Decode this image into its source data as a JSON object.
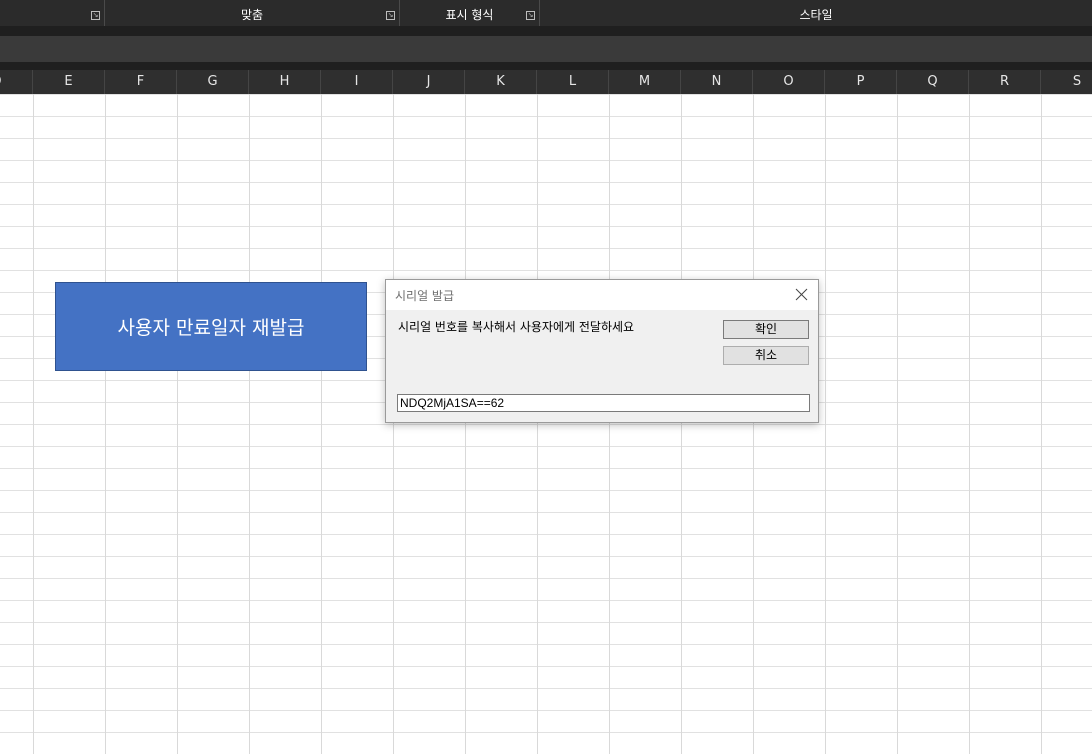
{
  "ribbon": {
    "groups": [
      {
        "label": ""
      },
      {
        "label": "맞춤"
      },
      {
        "label": "표시 형식"
      },
      {
        "label": "스타일"
      }
    ]
  },
  "columns": [
    "D",
    "E",
    "F",
    "G",
    "H",
    "I",
    "J",
    "K",
    "L",
    "M",
    "N",
    "O",
    "P",
    "Q",
    "R",
    "S"
  ],
  "shape_button": {
    "label": "사용자 만료일자 재발급"
  },
  "dialog": {
    "title": "시리얼 발급",
    "message": "시리얼 번호를 복사해서 사용자에게 전달하세요",
    "ok_label": "확인",
    "cancel_label": "취소",
    "input_value": "NDQ2MjA1SA==62"
  },
  "colors": {
    "shape_fill": "#4472c4",
    "ribbon_bg": "#2b2b2b",
    "header_bg": "#2f2f2f"
  }
}
